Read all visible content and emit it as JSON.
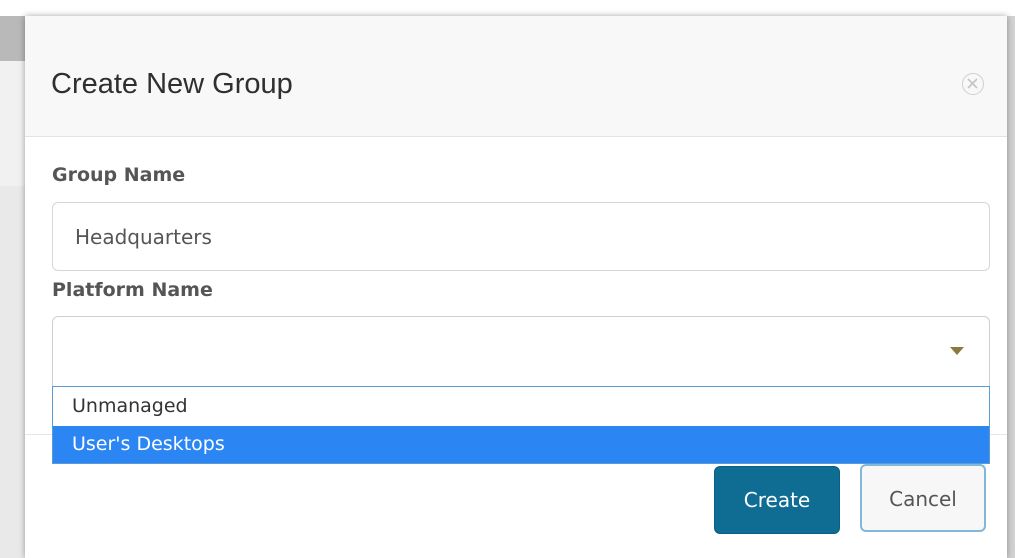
{
  "dialog": {
    "title": "Create New Group",
    "close_icon": "close-circle-icon"
  },
  "form": {
    "group_name": {
      "label": "Group Name",
      "value": "Headquarters"
    },
    "platform_name": {
      "label": "Platform Name",
      "value": "",
      "dropdown_icon": "caret-down-icon",
      "options": [
        "Unmanaged",
        "User's Desktops"
      ],
      "highlighted_option": "User's Desktops"
    }
  },
  "footer": {
    "create_label": "Create",
    "cancel_label": "Cancel"
  },
  "colors": {
    "primary_button": "#0f6d93",
    "highlight": "#2b86f3",
    "cancel_border": "#7fb8d8"
  }
}
